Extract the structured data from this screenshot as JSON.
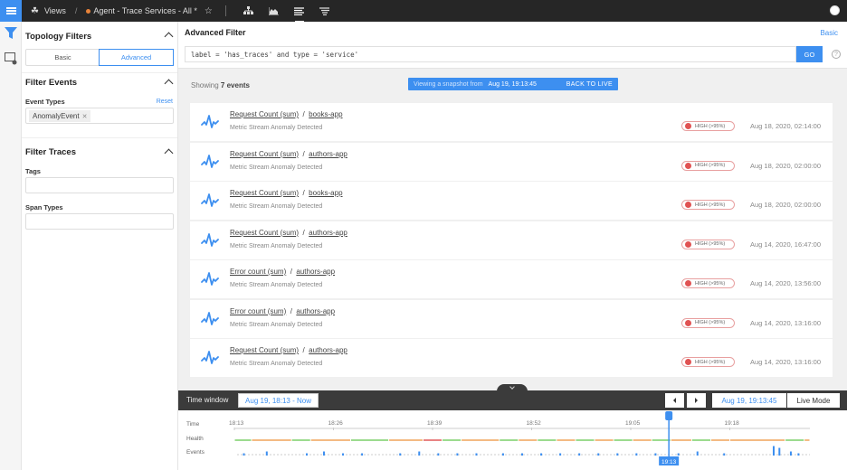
{
  "topbar": {
    "views_label": "Views",
    "separator": "/",
    "view_name": "Agent - Trace Services - All *",
    "icons": [
      "menu-icon",
      "views-icon",
      "star-icon",
      "topology-icon",
      "area-chart-icon",
      "events-list-icon",
      "traces-icon",
      "user-icon"
    ]
  },
  "sidebar": {
    "topology_filters": {
      "title": "Topology Filters",
      "modes": [
        "Basic",
        "Advanced"
      ],
      "active_mode": "Advanced"
    },
    "filter_events": {
      "title": "Filter Events",
      "event_types_label": "Event Types",
      "reset_label": "Reset",
      "selected_types": [
        "AnomalyEvent"
      ]
    },
    "filter_traces": {
      "title": "Filter Traces",
      "tags_label": "Tags",
      "tags_value": "",
      "span_types_label": "Span Types",
      "span_types_value": ""
    }
  },
  "filter": {
    "title": "Advanced Filter",
    "basic_link": "Basic",
    "query": "label = 'has_traces' and type = 'service'",
    "go_label": "GO",
    "help": "?"
  },
  "events_header": {
    "showing_prefix": "Showing",
    "count_label": "7 events",
    "snapshot_label": "Viewing a snapshot from",
    "snapshot_time": "Aug 19, 19:13:45",
    "back_to_live": "BACK TO LIVE"
  },
  "events": [
    {
      "metric": "Request Count (sum)",
      "component": "books-app",
      "subtitle": "Metric Stream Anomaly Detected",
      "severity": "HIGH (>95%)",
      "time": "Aug 18, 2020, 02:14:00"
    },
    {
      "metric": "Request Count (sum)",
      "component": "authors-app",
      "subtitle": "Metric Stream Anomaly Detected",
      "severity": "HIGH (>95%)",
      "time": "Aug 18, 2020, 02:00:00"
    },
    {
      "metric": "Request Count (sum)",
      "component": "books-app",
      "subtitle": "Metric Stream Anomaly Detected",
      "severity": "HIGH (>95%)",
      "time": "Aug 18, 2020, 02:00:00"
    },
    {
      "metric": "Request Count (sum)",
      "component": "authors-app",
      "subtitle": "Metric Stream Anomaly Detected",
      "severity": "HIGH (>95%)",
      "time": "Aug 14, 2020, 16:47:00"
    },
    {
      "metric": "Error count (sum)",
      "component": "authors-app",
      "subtitle": "Metric Stream Anomaly Detected",
      "severity": "HIGH (>95%)",
      "time": "Aug 14, 2020, 13:56:00"
    },
    {
      "metric": "Error count (sum)",
      "component": "authors-app",
      "subtitle": "Metric Stream Anomaly Detected",
      "severity": "HIGH (>95%)",
      "time": "Aug 14, 2020, 13:16:00"
    },
    {
      "metric": "Request Count (sum)",
      "component": "authors-app",
      "subtitle": "Metric Stream Anomaly Detected",
      "severity": "HIGH (>95%)",
      "time": "Aug 14, 2020, 13:16:00"
    }
  ],
  "timewindow": {
    "label": "Time window",
    "range": "Aug 19, 18:13 - Now",
    "current_time": "Aug 19, 19:13:45",
    "live_mode": "Live Mode",
    "row_labels": [
      "Time",
      "Health",
      "Events"
    ],
    "ticks": [
      "18:13",
      "18:26",
      "18:39",
      "18:52",
      "19:05",
      "19:18"
    ],
    "cursor_label": "19:13",
    "health_segments": [
      {
        "state": "green",
        "from": 0,
        "to": 0.09
      },
      {
        "state": "orange",
        "from": 0.09,
        "to": 0.3
      },
      {
        "state": "green",
        "from": 0.3,
        "to": 0.4
      },
      {
        "state": "orange",
        "from": 0.4,
        "to": 0.61
      },
      {
        "state": "green",
        "from": 0.61,
        "to": 0.81
      },
      {
        "state": "orange",
        "from": 0.81,
        "to": 0.99
      },
      {
        "state": "red",
        "from": 0.99,
        "to": 1.09
      },
      {
        "state": "green",
        "from": 1.09,
        "to": 1.19
      },
      {
        "state": "orange",
        "from": 1.19,
        "to": 1.39
      },
      {
        "state": "green",
        "from": 1.39,
        "to": 1.49
      },
      {
        "state": "orange",
        "from": 1.49,
        "to": 1.59
      },
      {
        "state": "green",
        "from": 1.59,
        "to": 1.69
      },
      {
        "state": "orange",
        "from": 1.69,
        "to": 1.79
      },
      {
        "state": "green",
        "from": 1.79,
        "to": 1.89
      },
      {
        "state": "orange",
        "from": 1.89,
        "to": 1.99
      },
      {
        "state": "green",
        "from": 1.99,
        "to": 2.09
      },
      {
        "state": "orange",
        "from": 2.09,
        "to": 2.19
      },
      {
        "state": "green",
        "from": 2.19,
        "to": 2.29
      },
      {
        "state": "orange",
        "from": 2.29,
        "to": 2.4
      },
      {
        "state": "green",
        "from": 2.4,
        "to": 2.5
      },
      {
        "state": "orange",
        "from": 2.5,
        "to": 2.6
      },
      {
        "state": "orange",
        "from": 2.6,
        "to": 2.89
      },
      {
        "state": "green",
        "from": 2.89,
        "to": 2.99
      },
      {
        "state": "orange",
        "from": 2.99,
        "to": 3.02
      }
    ],
    "event_markers": [
      {
        "t": 0.05,
        "h": 1
      },
      {
        "t": 0.17,
        "h": 3
      },
      {
        "t": 0.38,
        "h": 1
      },
      {
        "t": 0.47,
        "h": 3
      },
      {
        "t": 0.57,
        "h": 1
      },
      {
        "t": 0.67,
        "h": 1
      },
      {
        "t": 0.87,
        "h": 1
      },
      {
        "t": 0.97,
        "h": 3
      },
      {
        "t": 1.07,
        "h": 1
      },
      {
        "t": 1.17,
        "h": 1
      },
      {
        "t": 1.27,
        "h": 1
      },
      {
        "t": 1.41,
        "h": 1
      },
      {
        "t": 1.51,
        "h": 1
      },
      {
        "t": 1.61,
        "h": 1
      },
      {
        "t": 1.71,
        "h": 1
      },
      {
        "t": 1.81,
        "h": 1
      },
      {
        "t": 1.91,
        "h": 1
      },
      {
        "t": 2.01,
        "h": 1
      },
      {
        "t": 2.11,
        "h": 1
      },
      {
        "t": 2.21,
        "h": 1
      },
      {
        "t": 2.33,
        "h": 1
      },
      {
        "t": 2.43,
        "h": 3
      },
      {
        "t": 2.57,
        "h": 1
      },
      {
        "t": 2.83,
        "h": 9
      },
      {
        "t": 2.86,
        "h": 7
      },
      {
        "t": 2.92,
        "h": 3
      },
      {
        "t": 2.96,
        "h": 1
      }
    ],
    "cursor_t": 2.28,
    "t_max": 3.02
  },
  "colors": {
    "accent": "#3d8ff0",
    "health_green": "#7ccf6a",
    "health_orange": "#f0a45a",
    "health_red": "#e05a5a",
    "severity_high": "#e05252"
  }
}
